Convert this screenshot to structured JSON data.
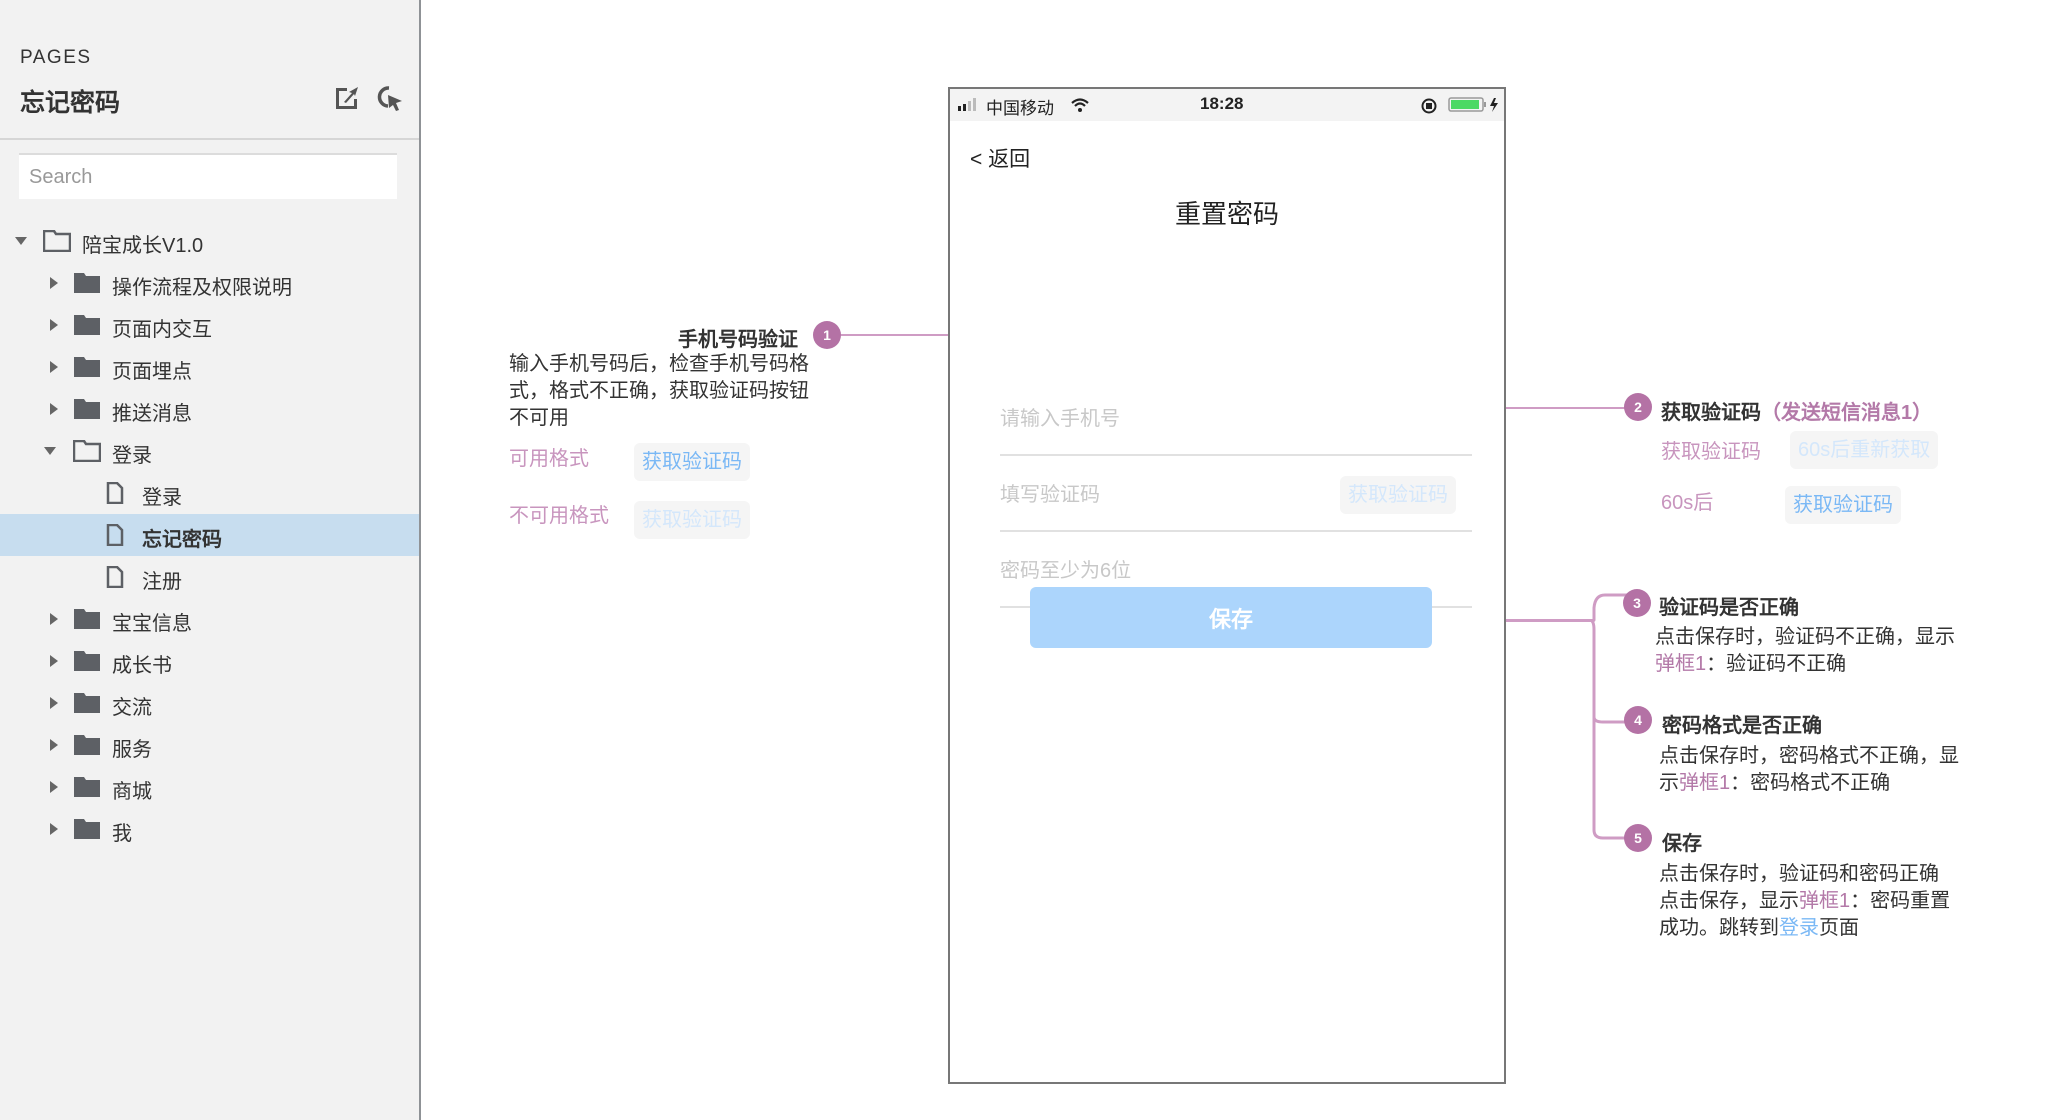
{
  "sidebar": {
    "section_label": "PAGES",
    "current_page": "忘记密码",
    "search": {
      "placeholder": "Search",
      "value": ""
    },
    "header_icons": [
      "export-icon",
      "pointer-select-icon"
    ],
    "tree": [
      {
        "label": "陪宝成长V1.0",
        "type": "folder",
        "expanded": true,
        "level": 0
      },
      {
        "label": "操作流程及权限说明",
        "type": "folder",
        "expanded": false,
        "level": 1
      },
      {
        "label": "页面内交互",
        "type": "folder",
        "expanded": false,
        "level": 1
      },
      {
        "label": "页面埋点",
        "type": "folder",
        "expanded": false,
        "level": 1
      },
      {
        "label": "推送消息",
        "type": "folder",
        "expanded": false,
        "level": 1
      },
      {
        "label": "登录",
        "type": "folder",
        "expanded": true,
        "level": 1
      },
      {
        "label": "登录",
        "type": "page",
        "level": 2
      },
      {
        "label": "忘记密码",
        "type": "page",
        "level": 2,
        "selected": true
      },
      {
        "label": "注册",
        "type": "page",
        "level": 2
      },
      {
        "label": "宝宝信息",
        "type": "folder",
        "expanded": false,
        "level": 1
      },
      {
        "label": "成长书",
        "type": "folder",
        "expanded": false,
        "level": 1
      },
      {
        "label": "交流",
        "type": "folder",
        "expanded": false,
        "level": 1
      },
      {
        "label": "服务",
        "type": "folder",
        "expanded": false,
        "level": 1
      },
      {
        "label": "商城",
        "type": "folder",
        "expanded": false,
        "level": 1
      },
      {
        "label": "我",
        "type": "folder",
        "expanded": false,
        "level": 1
      }
    ]
  },
  "phone": {
    "status_bar": {
      "carrier": "中国移动",
      "time": "18:28",
      "battery_color": "#4cd964"
    },
    "back_label": "< 返回",
    "title": "重置密码",
    "fields": [
      {
        "placeholder": "请输入手机号"
      },
      {
        "placeholder": "填写验证码",
        "action_label": "获取验证码"
      },
      {
        "placeholder": "密码至少为6位"
      }
    ],
    "save_label": "保存",
    "save_color": "#acd5fc"
  },
  "annotations": {
    "a1": {
      "number": "1",
      "title": "手机号码验证",
      "text": "输入手机号码后，检查手机号码格式，格式不正确，获取验证码按钮不可用",
      "examples": [
        {
          "label": "可用格式",
          "chip": "获取验证码",
          "state": "enabled"
        },
        {
          "label": "不可用格式",
          "chip": "获取验证码",
          "state": "disabled"
        }
      ]
    },
    "a2": {
      "number": "2",
      "title": "获取验证码",
      "title_suffix": "（发送短信消息1）",
      "examples": [
        {
          "label": "获取验证码",
          "chip": "60s后重新获取",
          "state": "disabled"
        },
        {
          "label": "60s后",
          "chip": "获取验证码",
          "state": "enabled"
        }
      ]
    },
    "a3": {
      "number": "3",
      "title": "验证码是否正确",
      "text_pre": "点击保存时，验证码不正确，显示",
      "text_link": "弹框1",
      "text_post": "：验证码不正确"
    },
    "a4": {
      "number": "4",
      "title": "密码格式是否正确",
      "text_pre": "点击保存时，密码格式不正确，显示",
      "text_link": "弹框1",
      "text_post": "：密码格式不正确"
    },
    "a5": {
      "number": "5",
      "title": "保存",
      "line1": "点击保存时，验证码和密码正确",
      "line2_pre": "点击保存，显示",
      "line2_link": "弹框1",
      "line2_post": "：密码重置",
      "line3_pre": "成功。跳转到",
      "line3_link": "登录",
      "line3_post": "页面"
    }
  },
  "colors": {
    "accent_pink": "#b472a5",
    "connector_pink": "#cf9cc4",
    "link_blue": "#7ab8f5",
    "selected_row": "#c7ddef"
  }
}
